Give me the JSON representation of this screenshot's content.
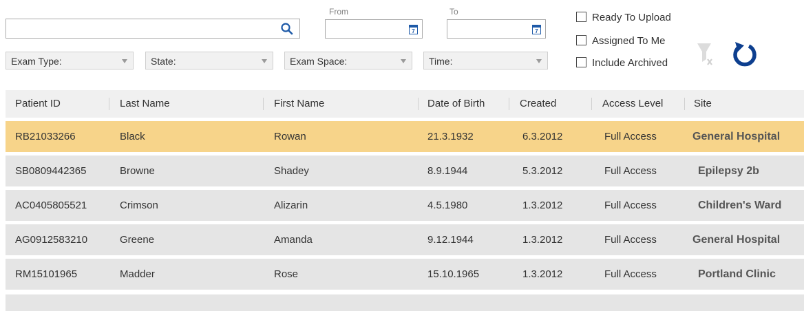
{
  "search": {
    "value": "",
    "placeholder": ""
  },
  "date_from": {
    "label": "From",
    "value": ""
  },
  "date_to": {
    "label": "To",
    "value": ""
  },
  "calendar_glyph": "7",
  "filters": {
    "exam_type": "Exam Type:",
    "state": "State:",
    "exam_space": "Exam Space:",
    "time": "Time:"
  },
  "checkboxes": {
    "ready_to_upload": {
      "label": "Ready To Upload",
      "checked": false
    },
    "assigned_to_me": {
      "label": "Assigned To Me",
      "checked": false
    },
    "include_archived": {
      "label": "Include Archived",
      "checked": false
    }
  },
  "icons": {
    "search": "search-icon",
    "calendar": "calendar-icon",
    "clear_filter": "clear-filter-icon",
    "refresh": "refresh-icon"
  },
  "colors": {
    "selected_row": "#f7d48a",
    "row": "#e5e5e5",
    "header": "#f0f0f0",
    "refresh_icon": "#0d3f8f",
    "clear_filter_icon": "#d9d9d9"
  },
  "table": {
    "columns": [
      "Patient ID",
      "Last Name",
      "First Name",
      "Date of Birth",
      "Created",
      "Access Level",
      "Site"
    ],
    "rows": [
      [
        "RB21033266",
        "Black",
        "Rowan",
        "21.3.1932",
        "6.3.2012",
        "Full Access",
        "General Hospital"
      ],
      [
        "SB0809442365",
        "Browne",
        "Shadey",
        "8.9.1944",
        "5.3.2012",
        "Full Access",
        "Epilepsy 2b"
      ],
      [
        "AC0405805521",
        "Crimson",
        "Alizarin",
        "4.5.1980",
        "1.3.2012",
        "Full Access",
        "Children's Ward"
      ],
      [
        "AG0912583210",
        "Greene",
        "Amanda",
        "9.12.1944",
        "1.3.2012",
        "Full Access",
        "General Hospital"
      ],
      [
        "RM15101965",
        "Madder",
        "Rose",
        "15.10.1965",
        "1.3.2012",
        "Full Access",
        "Portland Clinic"
      ]
    ],
    "selected_row": 0
  }
}
